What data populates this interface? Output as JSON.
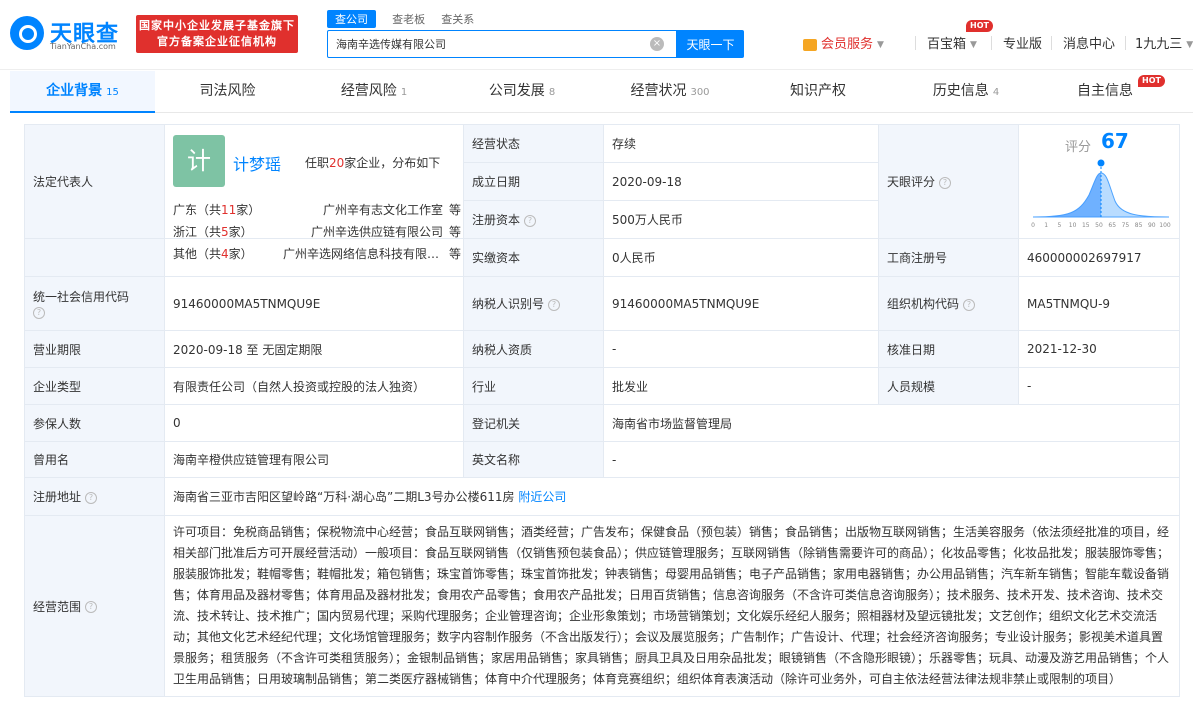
{
  "header": {
    "logo_text": "天眼查",
    "logo_sub": "TianYanCha.com",
    "gov_badge_line1": "国家中小企业发展子基金旗下",
    "gov_badge_line2": "官方备案企业征信机构",
    "search_tabs": [
      "查公司",
      "查老板",
      "查关系"
    ],
    "search_value": "海南辛选传媒有限公司",
    "search_button": "天眼一下",
    "member_label": "会员服务",
    "baibaoxiang": "百宝箱",
    "hot": "HOT",
    "pro": "专业版",
    "messages": "消息中心",
    "user": "1九九三"
  },
  "tabs": [
    {
      "label": "企业背景",
      "count": "15"
    },
    {
      "label": "司法风险",
      "count": ""
    },
    {
      "label": "经营风险",
      "count": "1"
    },
    {
      "label": "公司发展",
      "count": "8"
    },
    {
      "label": "经营状况",
      "count": "300"
    },
    {
      "label": "知识产权",
      "count": ""
    },
    {
      "label": "历史信息",
      "count": "4"
    },
    {
      "label": "自主信息",
      "count": ""
    }
  ],
  "legal_rep": {
    "label": "法定代表人",
    "avatar": "计",
    "name": "计梦瑶",
    "info_prefix": "任职",
    "info_count": "20",
    "info_suffix": "家企业，分布如下",
    "regions": [
      {
        "prov": "广东（共",
        "num": "11",
        "unit": "家）",
        "org": "广州辛有志文化工作室",
        "tail": "等"
      },
      {
        "prov": "浙江（共",
        "num": "5",
        "unit": "家）",
        "org": "广州辛选供应链有限公司",
        "tail": "等"
      },
      {
        "prov": "其他（共",
        "num": "4",
        "unit": "家）",
        "org": "广州辛选网络信息科技有限公司",
        "tail": "等"
      }
    ]
  },
  "rows": {
    "status_label": "经营状态",
    "status_value": "存续",
    "founded_label": "成立日期",
    "founded_value": "2020-09-18",
    "capital_label": "注册资本",
    "capital_value": "500万人民币",
    "paid_label": "实缴资本",
    "paid_value": "0人民币",
    "tianyan_label": "天眼评分",
    "score_label": "评分",
    "score_value": "67",
    "reg_no_label": "工商注册号",
    "reg_no_value": "460000002697917",
    "credit_label": "统一社会信用代码",
    "credit_value": "91460000MA5TNMQU9E",
    "taxpayer_label": "纳税人识别号",
    "taxpayer_value": "91460000MA5TNMQU9E",
    "org_code_label": "组织机构代码",
    "org_code_value": "MA5TNMQU-9",
    "term_label": "营业期限",
    "term_value": "2020-09-18 至 无固定期限",
    "tax_qual_label": "纳税人资质",
    "tax_qual_value": "-",
    "approve_label": "核准日期",
    "approve_value": "2021-12-30",
    "type_label": "企业类型",
    "type_value": "有限责任公司（自然人投资或控股的法人独资）",
    "industry_label": "行业",
    "industry_value": "批发业",
    "staff_label": "人员规模",
    "staff_value": "-",
    "insured_label": "参保人数",
    "insured_value": "0",
    "authority_label": "登记机关",
    "authority_value": "海南省市场监督管理局",
    "former_label": "曾用名",
    "former_value": "海南辛橙供应链管理有限公司",
    "english_label": "英文名称",
    "english_value": "-",
    "address_label": "注册地址",
    "address_value": "海南省三亚市吉阳区望岭路“万科·湖心岛”二期L3号办公楼611房",
    "nearby": "附近公司",
    "scope_label": "经营范围",
    "scope_value": "许可项目：免税商品销售；保税物流中心经营；食品互联网销售；酒类经营；广告发布；保健食品（预包装）销售；食品销售；出版物互联网销售；生活美容服务（依法须经批准的项目，经相关部门批准后方可开展经营活动）一般项目：食品互联网销售（仅销售预包装食品）；供应链管理服务；互联网销售（除销售需要许可的商品）；化妆品零售；化妆品批发；服装服饰零售；服装服饰批发；鞋帽零售；鞋帽批发；箱包销售；珠宝首饰零售；珠宝首饰批发；钟表销售；母婴用品销售；电子产品销售；家用电器销售；办公用品销售；汽车新车销售；智能车载设备销售；体育用品及器材零售；体育用品及器材批发；食用农产品零售；食用农产品批发；日用百货销售；信息咨询服务（不含许可类信息咨询服务）；技术服务、技术开发、技术咨询、技术交流、技术转让、技术推广；国内贸易代理；采购代理服务；企业管理咨询；企业形象策划；市场营销策划；文化娱乐经纪人服务；照相器材及望远镜批发；文艺创作；组织文化艺术交流活动；其他文化艺术经纪代理；文化场馆管理服务；数字内容制作服务（不含出版发行）；会议及展览服务；广告制作；广告设计、代理；社会经济咨询服务；专业设计服务；影视美术道具置景服务；租赁服务（不含许可类租赁服务）；金银制品销售；家居用品销售；家具销售；厨具卫具及日用杂品批发；眼镜销售（不含隐形眼镜）；乐器零售；玩具、动漫及游艺用品销售；个人卫生用品销售；日用玻璃制品销售；第二类医疗器械销售；体育中介代理服务；体育竞赛组织；组织体育表演活动（除许可业务外，可自主依法经营法律法规非禁止或限制的项目）"
  },
  "score_axis": [
    "0",
    "1",
    "5",
    "10",
    "15",
    "50",
    "65",
    "75",
    "85",
    "90",
    "100"
  ],
  "colors": {
    "accent": "#0084ff",
    "red": "#e0302d"
  }
}
